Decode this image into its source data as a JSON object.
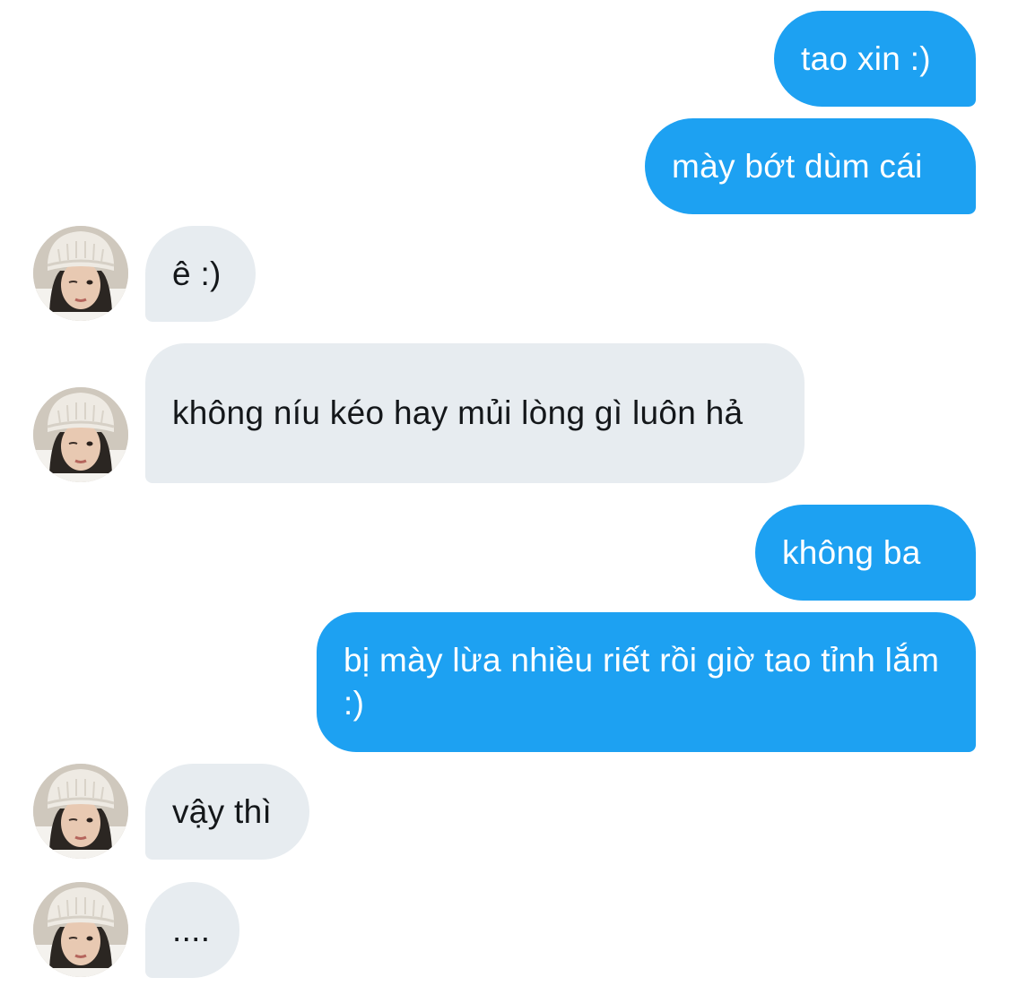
{
  "conversation": {
    "messages": [
      {
        "direction": "sent",
        "text": "tao xin :)"
      },
      {
        "direction": "sent",
        "text": "mày bớt dùm cái"
      },
      {
        "direction": "received",
        "text": "ê :)"
      },
      {
        "direction": "received",
        "text": "không níu kéo hay mủi lòng gì luôn hả"
      },
      {
        "direction": "sent",
        "text": "không ba"
      },
      {
        "direction": "sent",
        "text": "bị mày lừa nhiều riết rồi giờ tao tỉnh lắm :)"
      },
      {
        "direction": "received",
        "text": "vậy thì"
      },
      {
        "direction": "received",
        "text": "...."
      }
    ]
  },
  "theme": {
    "sent_bubble_color": "#1da1f2",
    "received_bubble_color": "#e7ecf0",
    "sent_text_color": "#ffffff",
    "received_text_color": "#14171a"
  },
  "avatar": {
    "icon": "user-avatar-photo"
  }
}
